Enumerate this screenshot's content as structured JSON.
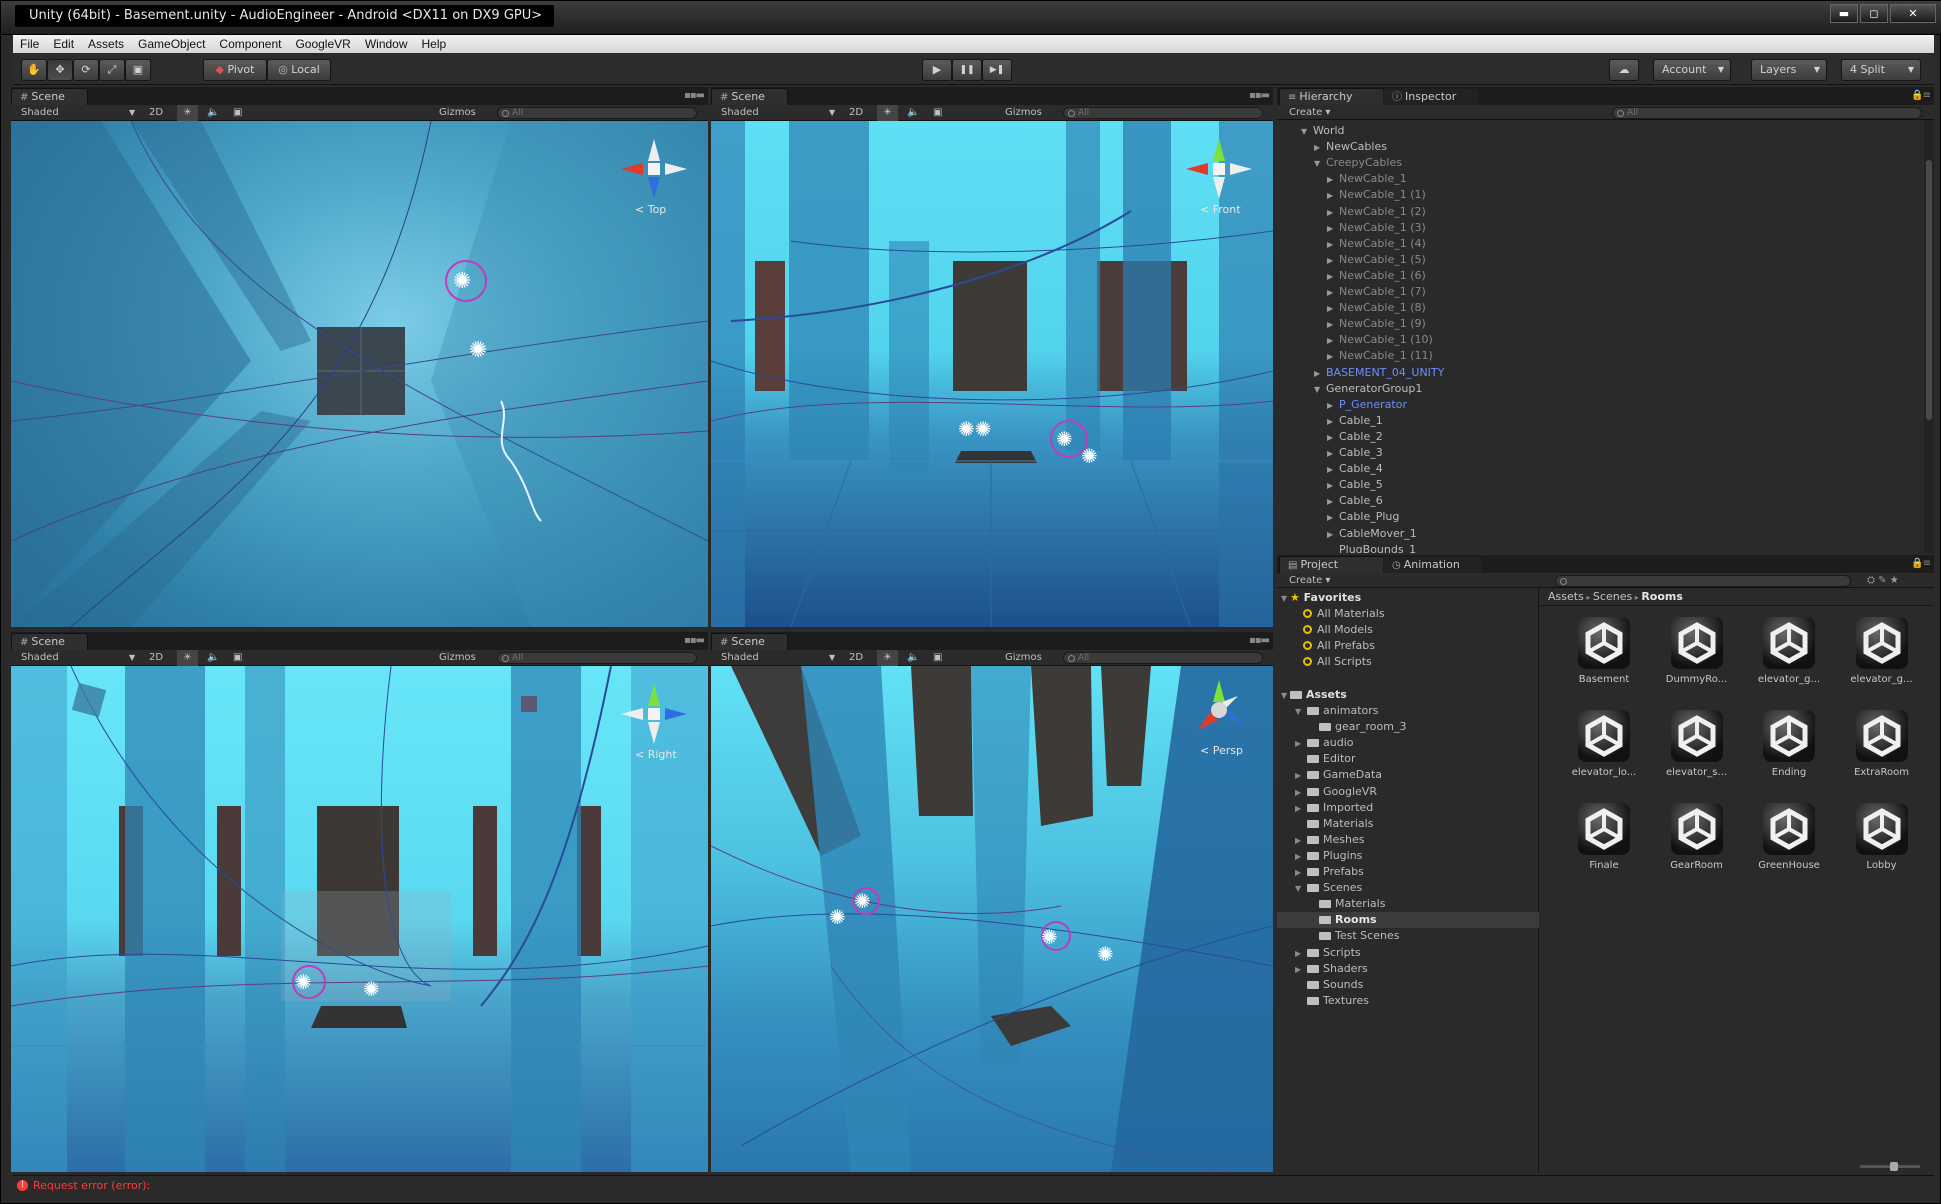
{
  "window": {
    "title": "Unity (64bit) - Basement.unity - AudioEngineer - Android <DX11 on DX9 GPU>",
    "min": "▬",
    "max": "◻",
    "close": "✕"
  },
  "menu": [
    "File",
    "Edit",
    "Assets",
    "GameObject",
    "Component",
    "GoogleVR",
    "Window",
    "Help"
  ],
  "toolbar": {
    "pivot": "Pivot",
    "local": "Local",
    "account": "Account",
    "layers": "Layers",
    "layout": "4 Split",
    "play": "▶",
    "pause": "❚❚",
    "step": "▶❚"
  },
  "scene_tab": "Scene",
  "scene_ctrl": {
    "shaded": "Shaded",
    "mode2d": "2D",
    "gizmos": "Gizmos",
    "search": "All"
  },
  "views": {
    "top": "Top",
    "front": "Front",
    "right": "Right",
    "persp": "Persp"
  },
  "hierarchy": {
    "tab": "Hierarchy",
    "inspector_tab": "Inspector",
    "create": "Create",
    "search": "All",
    "rows": [
      {
        "t": "World",
        "d": 0,
        "a": "▼",
        "c": ""
      },
      {
        "t": "NewCables",
        "d": 1,
        "a": "▶",
        "c": ""
      },
      {
        "t": "CreepyCables",
        "d": 1,
        "a": "▼",
        "c": "dim"
      },
      {
        "t": "NewCable_1",
        "d": 2,
        "a": "▶",
        "c": "dim"
      },
      {
        "t": "NewCable_1 (1)",
        "d": 2,
        "a": "▶",
        "c": "dim"
      },
      {
        "t": "NewCable_1 (2)",
        "d": 2,
        "a": "▶",
        "c": "dim"
      },
      {
        "t": "NewCable_1 (3)",
        "d": 2,
        "a": "▶",
        "c": "dim"
      },
      {
        "t": "NewCable_1 (4)",
        "d": 2,
        "a": "▶",
        "c": "dim"
      },
      {
        "t": "NewCable_1 (5)",
        "d": 2,
        "a": "▶",
        "c": "dim"
      },
      {
        "t": "NewCable_1 (6)",
        "d": 2,
        "a": "▶",
        "c": "dim"
      },
      {
        "t": "NewCable_1 (7)",
        "d": 2,
        "a": "▶",
        "c": "dim"
      },
      {
        "t": "NewCable_1 (8)",
        "d": 2,
        "a": "▶",
        "c": "dim"
      },
      {
        "t": "NewCable_1 (9)",
        "d": 2,
        "a": "▶",
        "c": "dim"
      },
      {
        "t": "NewCable_1 (10)",
        "d": 2,
        "a": "▶",
        "c": "dim"
      },
      {
        "t": "NewCable_1 (11)",
        "d": 2,
        "a": "▶",
        "c": "dim"
      },
      {
        "t": "BASEMENT_04_UNITY",
        "d": 1,
        "a": "▶",
        "c": "blue"
      },
      {
        "t": "GeneratorGroup1",
        "d": 1,
        "a": "▼",
        "c": ""
      },
      {
        "t": "P_Generator",
        "d": 2,
        "a": "▶",
        "c": "blue"
      },
      {
        "t": "Cable_1",
        "d": 2,
        "a": "▶",
        "c": ""
      },
      {
        "t": "Cable_2",
        "d": 2,
        "a": "▶",
        "c": ""
      },
      {
        "t": "Cable_3",
        "d": 2,
        "a": "▶",
        "c": ""
      },
      {
        "t": "Cable_4",
        "d": 2,
        "a": "▶",
        "c": ""
      },
      {
        "t": "Cable_5",
        "d": 2,
        "a": "▶",
        "c": ""
      },
      {
        "t": "Cable_6",
        "d": 2,
        "a": "▶",
        "c": ""
      },
      {
        "t": "Cable_Plug",
        "d": 2,
        "a": "▶",
        "c": ""
      },
      {
        "t": "CableMover_1",
        "d": 2,
        "a": "▶",
        "c": ""
      },
      {
        "t": "PlugBounds_1",
        "d": 2,
        "a": "",
        "c": ""
      }
    ]
  },
  "project": {
    "tab": "Project",
    "animation_tab": "Animation",
    "create": "Create",
    "breadcrumb": [
      "Assets",
      "Scenes",
      "Rooms"
    ],
    "favorites_label": "Favorites",
    "favorites": [
      "All Materials",
      "All Models",
      "All Prefabs",
      "All Scripts"
    ],
    "assets_label": "Assets",
    "tree": [
      {
        "t": "animators",
        "d": 1,
        "a": "▼"
      },
      {
        "t": "gear_room_3",
        "d": 2,
        "a": ""
      },
      {
        "t": "audio",
        "d": 1,
        "a": "▶"
      },
      {
        "t": "Editor",
        "d": 1,
        "a": ""
      },
      {
        "t": "GameData",
        "d": 1,
        "a": "▶"
      },
      {
        "t": "GoogleVR",
        "d": 1,
        "a": "▶"
      },
      {
        "t": "Imported",
        "d": 1,
        "a": "▶"
      },
      {
        "t": "Materials",
        "d": 1,
        "a": ""
      },
      {
        "t": "Meshes",
        "d": 1,
        "a": "▶"
      },
      {
        "t": "Plugins",
        "d": 1,
        "a": "▶"
      },
      {
        "t": "Prefabs",
        "d": 1,
        "a": "▶"
      },
      {
        "t": "Scenes",
        "d": 1,
        "a": "▼"
      },
      {
        "t": "Materials",
        "d": 2,
        "a": ""
      },
      {
        "t": "Rooms",
        "d": 2,
        "a": ""
      },
      {
        "t": "Test Scenes",
        "d": 2,
        "a": ""
      },
      {
        "t": "Scripts",
        "d": 1,
        "a": "▶"
      },
      {
        "t": "Shaders",
        "d": 1,
        "a": "▶"
      },
      {
        "t": "Sounds",
        "d": 1,
        "a": ""
      },
      {
        "t": "Textures",
        "d": 1,
        "a": ""
      }
    ],
    "assets": [
      "Basement",
      "DummyRo...",
      "elevator_g...",
      "elevator_g...",
      "elevator_lo...",
      "elevator_s...",
      "Ending",
      "ExtraRoom",
      "Finale",
      "GearRoom",
      "GreenHouse",
      "Lobby"
    ]
  },
  "status": {
    "error": "Request error (error):",
    "error_color": "#ff3b3b"
  }
}
